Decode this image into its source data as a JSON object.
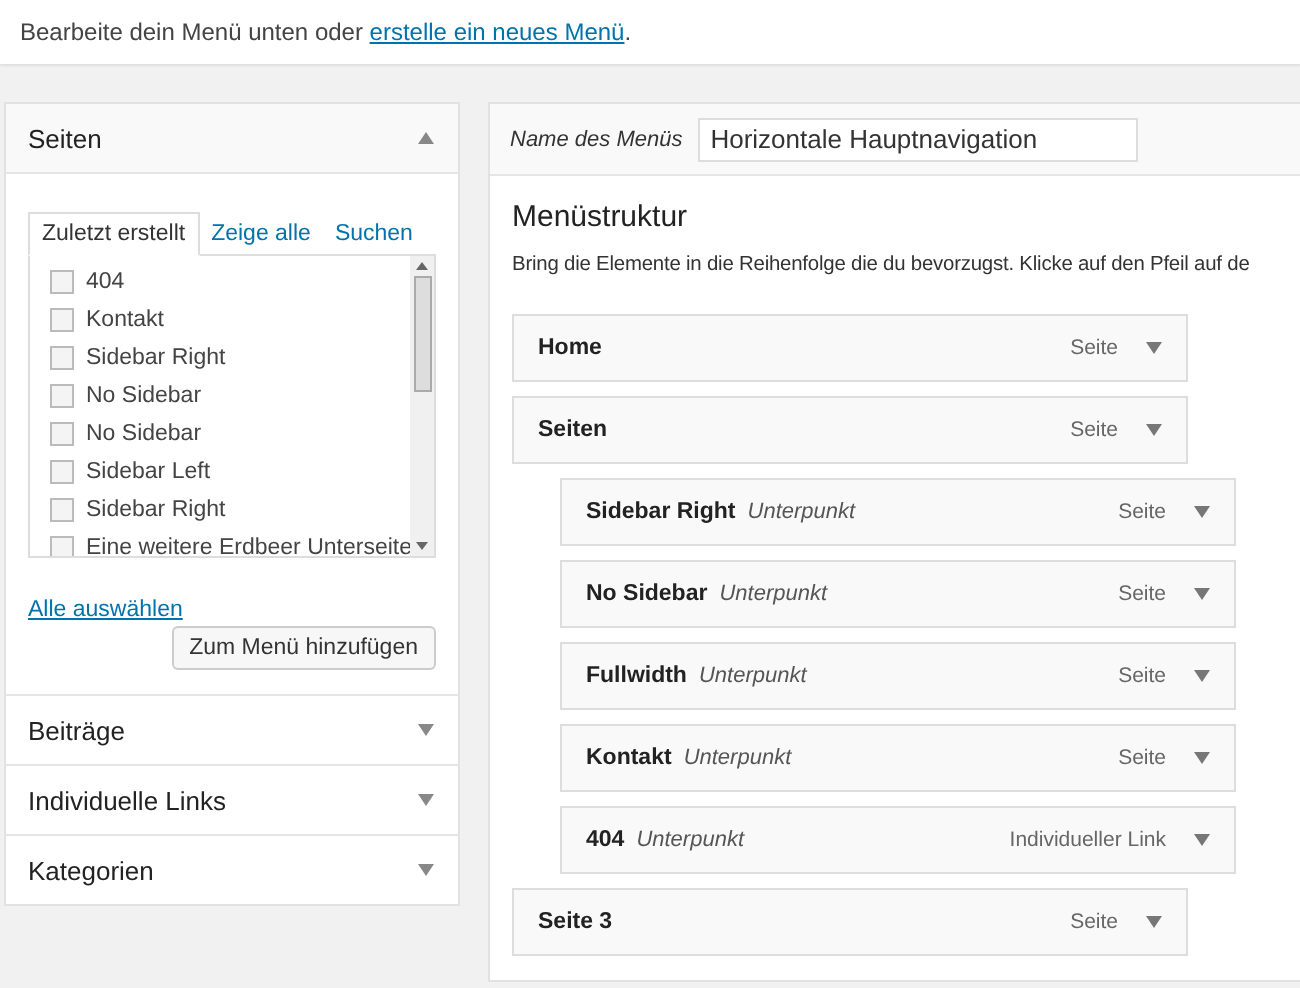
{
  "notice": {
    "text": "Bearbeite dein Menü unten oder ",
    "link": "erstelle ein neues Menü",
    "after": "."
  },
  "sections": [
    {
      "title": "Seiten",
      "expanded": true
    },
    {
      "title": "Beiträge",
      "expanded": false
    },
    {
      "title": "Individuelle Links",
      "expanded": false
    },
    {
      "title": "Kategorien",
      "expanded": false
    }
  ],
  "pages_box": {
    "tabs": [
      {
        "label": "Zuletzt erstellt",
        "selected": true
      },
      {
        "label": "Zeige alle",
        "selected": false
      },
      {
        "label": "Suchen",
        "selected": false
      }
    ],
    "items": [
      {
        "label": "404",
        "checked": false
      },
      {
        "label": "Kontakt",
        "checked": false
      },
      {
        "label": "Sidebar Right",
        "checked": false
      },
      {
        "label": "No Sidebar",
        "checked": false
      },
      {
        "label": "No Sidebar",
        "checked": false
      },
      {
        "label": "Sidebar Left",
        "checked": false
      },
      {
        "label": "Sidebar Right",
        "checked": false
      },
      {
        "label": "Eine weitere Erdbeer Unterseite",
        "checked": false
      }
    ],
    "select_all": "Alle auswählen",
    "add_button": "Zum Menü hinzufügen"
  },
  "menu_name": {
    "label": "Name des Menüs",
    "value": "Horizontale Hauptnavigation"
  },
  "structure": {
    "title": "Menüstruktur",
    "description": "Bring die Elemente in die Reihenfolge die du bevorzugst. Klicke auf den Pfeil auf de",
    "items": [
      {
        "title": "Home",
        "type": "Seite"
      },
      {
        "title": "Seiten",
        "type": "Seite",
        "children": [
          {
            "title": "Sidebar Right",
            "sub": "Unterpunkt",
            "type": "Seite"
          },
          {
            "title": "No Sidebar",
            "sub": "Unterpunkt",
            "type": "Seite"
          },
          {
            "title": "Fullwidth",
            "sub": "Unterpunkt",
            "type": "Seite"
          },
          {
            "title": "Kontakt",
            "sub": "Unterpunkt",
            "type": "Seite"
          },
          {
            "title": "404",
            "sub": "Unterpunkt",
            "type": "Individueller Link"
          }
        ]
      },
      {
        "title": "Seite 3",
        "type": "Seite"
      }
    ]
  }
}
